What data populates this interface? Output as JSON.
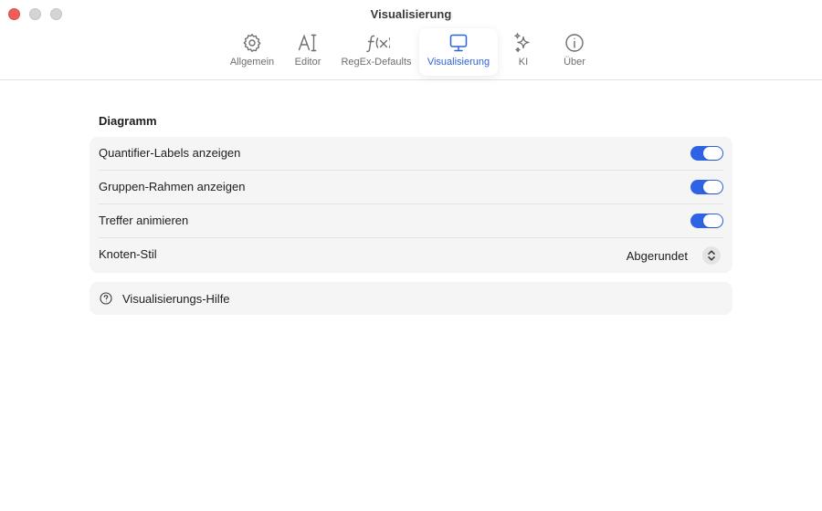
{
  "window": {
    "title": "Visualisierung"
  },
  "toolbar": {
    "tabs": [
      {
        "label": "Allgemein",
        "icon": "gear-icon"
      },
      {
        "label": "Editor",
        "icon": "text-cursor-icon"
      },
      {
        "label": "RegEx-Defaults",
        "icon": "function-icon"
      },
      {
        "label": "Visualisierung",
        "icon": "display-icon",
        "active": true
      },
      {
        "label": "KI",
        "icon": "sparkles-icon"
      },
      {
        "label": "Über",
        "icon": "info-icon"
      }
    ],
    "accent_color": "#2b62e0"
  },
  "diagram": {
    "header": "Diagramm",
    "rows": [
      {
        "label": "Quantifier-Labels anzeigen",
        "type": "toggle",
        "on": true
      },
      {
        "label": "Gruppen-Rahmen anzeigen",
        "type": "toggle",
        "on": true
      },
      {
        "label": "Treffer animieren",
        "type": "toggle",
        "on": true
      },
      {
        "label": "Knoten-Stil",
        "type": "select",
        "value": "Abgerundet"
      }
    ],
    "toggle_color": "#2f63e6"
  },
  "help": {
    "label": "Visualisierungs-Hilfe",
    "icon": "question-circle-icon"
  }
}
